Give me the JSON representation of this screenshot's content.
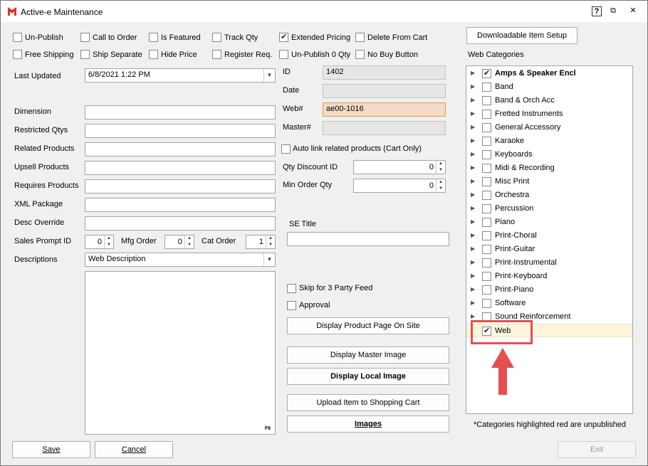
{
  "window": {
    "title": "Active-e Maintenance",
    "help": "?",
    "restore": "⧉",
    "close": "✕"
  },
  "top_checks": [
    {
      "label": "Un-Publish",
      "checked": false
    },
    {
      "label": "Call to Order",
      "checked": false
    },
    {
      "label": "Is Featured",
      "checked": false
    },
    {
      "label": "Track Qty",
      "checked": false
    },
    {
      "label": "Extended Pricing",
      "checked": true
    },
    {
      "label": "Delete From Cart",
      "checked": false
    },
    {
      "label": "Free Shipping",
      "checked": false
    },
    {
      "label": "Ship Separate",
      "checked": false
    },
    {
      "label": "Hide Price",
      "checked": false
    },
    {
      "label": "Register Req.",
      "checked": false
    },
    {
      "label": "Un-Publish 0 Qty",
      "checked": false
    },
    {
      "label": "No Buy Button",
      "checked": false
    }
  ],
  "last_updated": {
    "label": "Last Updated",
    "value": "6/8/2021 1:22 PM"
  },
  "fields": {
    "dimension": {
      "label": "Dimension",
      "value": ""
    },
    "restricted_qtys": {
      "label": "Restricted Qtys",
      "value": ""
    },
    "related_products": {
      "label": "Related Products",
      "value": ""
    },
    "upsell_products": {
      "label": "Upsell Products",
      "value": ""
    },
    "requires_products": {
      "label": "Requires Products",
      "value": ""
    },
    "xml_package": {
      "label": "XML Package",
      "value": ""
    },
    "desc_override": {
      "label": "Desc Override",
      "value": ""
    }
  },
  "spinners": {
    "sales_prompt": {
      "label": "Sales Prompt ID",
      "value": "0"
    },
    "mfg_order": {
      "label": "Mfg Order",
      "value": "0"
    },
    "cat_order": {
      "label": "Cat Order",
      "value": "1"
    },
    "qty_discount": {
      "label": "Qty Discount ID",
      "value": "0"
    },
    "min_order": {
      "label": "Min Order Qty",
      "value": "0"
    }
  },
  "descriptions": {
    "label": "Descriptions",
    "value": "Web Description",
    "memo_text": "",
    "memo_hint": "F6"
  },
  "mid": {
    "id": {
      "label": "ID",
      "value": "1402"
    },
    "date": {
      "label": "Date",
      "value": ""
    },
    "web": {
      "label": "Web#",
      "value": "ae00-1016"
    },
    "master": {
      "label": "Master#",
      "value": ""
    },
    "auto_link": {
      "label": "Auto link related products (Cart Only)",
      "checked": false
    },
    "se_title": {
      "label": "SE Title",
      "value": ""
    },
    "skip_feed": {
      "label": "Skip for 3 Party Feed",
      "checked": false
    },
    "approval": {
      "label": "Approval",
      "checked": false
    }
  },
  "buttons": {
    "display_product": "Display Product Page On Site",
    "display_master": "Display Master Image",
    "display_local": "Display Local Image",
    "upload": "Upload Item to Shopping Cart",
    "images": "Images",
    "downloadable": "Downloadable Item Setup",
    "save": "Save",
    "cancel": "Cancel",
    "exit": "Exit"
  },
  "web_categories": {
    "label": "Web Categories",
    "note": "*Categories highlighted red are unpublished",
    "items": [
      {
        "label": "Amps & Speaker Encl",
        "checked": true,
        "bold": true
      },
      {
        "label": "Band",
        "checked": false
      },
      {
        "label": "Band & Orch Acc",
        "checked": false
      },
      {
        "label": "Fretted Instruments",
        "checked": false
      },
      {
        "label": "General Accessory",
        "checked": false
      },
      {
        "label": "Karaoke",
        "checked": false
      },
      {
        "label": "Keyboards",
        "checked": false
      },
      {
        "label": "Midi & Recording",
        "checked": false
      },
      {
        "label": "Misc Print",
        "checked": false
      },
      {
        "label": "Orchestra",
        "checked": false
      },
      {
        "label": "Percussion",
        "checked": false
      },
      {
        "label": "Piano",
        "checked": false
      },
      {
        "label": "Print-Choral",
        "checked": false
      },
      {
        "label": "Print-Guitar",
        "checked": false
      },
      {
        "label": "Print-Instrumental",
        "checked": false
      },
      {
        "label": "Print-Keyboard",
        "checked": false
      },
      {
        "label": "Print-Piano",
        "checked": false
      },
      {
        "label": "Software",
        "checked": false
      },
      {
        "label": "Sound Reinforcement",
        "checked": false
      },
      {
        "label": "Web",
        "checked": true,
        "selected": true
      }
    ]
  },
  "colors": {
    "annotation": "#e45050",
    "focus_field": "#f4dcc4"
  }
}
